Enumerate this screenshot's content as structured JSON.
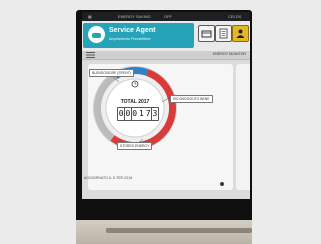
{
  "statusbar": {
    "left_icon": "signal-icon",
    "energy_saving_label": "ENERGY SAVING",
    "state_label": "OFF",
    "brand_label": "CELDS"
  },
  "header": {
    "agent_title": "Service Agent",
    "agent_subtitle": "Ampliamento Freestelliner",
    "accent_color": "#26a3b8",
    "buttons": [
      {
        "icon": "tray-icon"
      },
      {
        "icon": "document-icon"
      },
      {
        "icon": "person-icon"
      }
    ]
  },
  "toolbar": {
    "menu_icon": "menu-icon",
    "tab_label": "ENERGY MONITOR"
  },
  "gauge": {
    "total_label": "TOTAL 2017",
    "digits": [
      "0",
      "0",
      "0",
      "1",
      "7",
      "3"
    ],
    "segments": [
      {
        "label": "BLENDOSIDRE (SPENT)",
        "color": "#2f82c6",
        "fraction": 0.14
      },
      {
        "label": "RICONOSCIUTO BENE",
        "color": "#d93a3a",
        "fraction": 0.55
      },
      {
        "label": "STORED ENERGY",
        "color": "#bcbcbc",
        "fraction": 0.31
      }
    ],
    "since_text": "AGGIORNATO IL 5-TER 2018"
  }
}
